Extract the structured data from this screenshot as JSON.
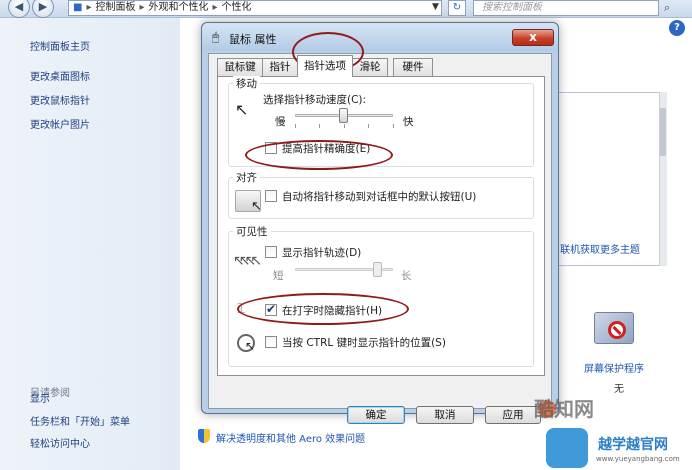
{
  "explorer": {
    "breadcrumb": [
      "控制面板",
      "外观和个性化",
      "个性化"
    ],
    "search_placeholder": "搜索控制面板",
    "left_links": [
      "控制面板主页",
      "更改桌面图标",
      "更改鼠标指针",
      "更改帐户图片"
    ],
    "see_also_title": "另请参阅",
    "see_also_links": [
      "显示",
      "任务栏和「开始」菜单",
      "轻松访问中心"
    ],
    "more_themes_link": "联机获取更多主题",
    "screensaver_label": "屏幕保护程序",
    "screensaver_value": "无",
    "aero_link": "解决透明度和其他 Aero 效果问题"
  },
  "dialog": {
    "title": "鼠标 属性",
    "close_glyph": "x",
    "tabs": [
      {
        "label": "鼠标键",
        "active": false
      },
      {
        "label": "指针",
        "active": false
      },
      {
        "label": "指针选项",
        "active": true
      },
      {
        "label": "滑轮",
        "active": false
      },
      {
        "label": "硬件",
        "active": false
      }
    ],
    "motion": {
      "group_title": "移动",
      "speed_label": "选择指针移动速度(C):",
      "slow": "慢",
      "fast": "快",
      "speed_level": 0.5,
      "precision_label": "提高指针精确度(E)",
      "precision_checked": false
    },
    "snap": {
      "group_title": "对齐",
      "label": "自动将指针移动到对话框中的默认按钮(U)",
      "checked": false
    },
    "visibility": {
      "group_title": "可见性",
      "trails_label": "显示指针轨迹(D)",
      "trails_checked": false,
      "short": "短",
      "long": "长",
      "trails_level": 0.85,
      "hide_typing_label": "在打字时隐藏指针(H)",
      "hide_typing_checked": true,
      "ctrl_label": "当按 CTRL 键时显示指针的位置(S)",
      "ctrl_checked": false
    },
    "buttons": {
      "ok": "确定",
      "cancel": "取消",
      "apply": "应用"
    }
  },
  "watermark": {
    "line1": "酷知网",
    "line2": "越学越官网",
    "line3": "www.yueyangbang.com"
  },
  "colors": {
    "ring": "#8e1a1a",
    "close": "#c8412b",
    "link": "#1f55b5"
  }
}
